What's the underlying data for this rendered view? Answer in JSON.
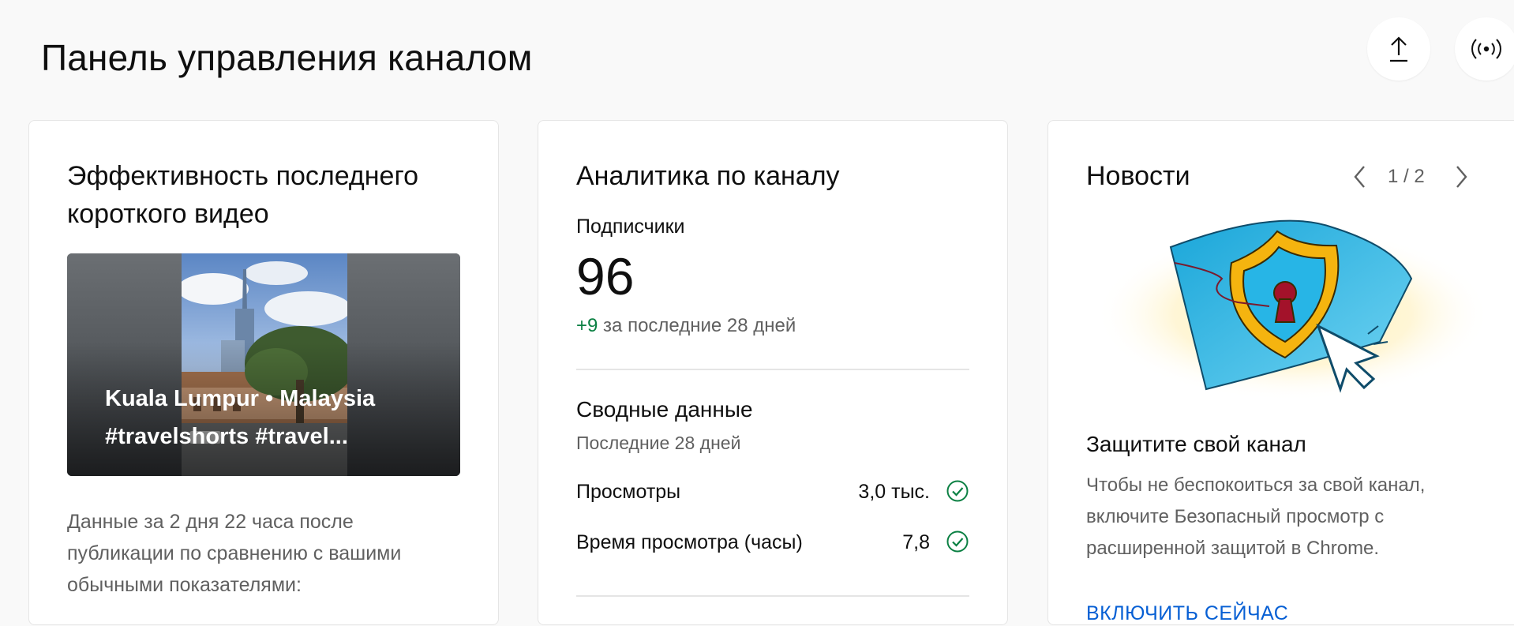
{
  "page": {
    "title": "Панель управления каналом",
    "actions": [
      {
        "icon": "upload-icon"
      },
      {
        "icon": "live-broadcast-icon"
      }
    ]
  },
  "short_video_card": {
    "title_line1": "Эффективность последнего",
    "title_line2": "короткого видео",
    "video_caption_line1": "Kuala Lumpur • Malaysia",
    "video_caption_line2": "#travelshorts #travel...",
    "note_line1": "Данные за 2 дня 22 часа после",
    "note_line2": "публикации по сравнению с вашими",
    "note_line3": "обычными показателями:"
  },
  "analytics_card": {
    "title": "Аналитика по каналу",
    "subscribers_label": "Подписчики",
    "subscribers_value": "96",
    "subscribers_delta": "+9",
    "subscribers_delta_period": "за последние 28 дней",
    "summary_title": "Сводные данные",
    "summary_period": "Последние 28 дней",
    "metrics": [
      {
        "label": "Просмотры",
        "value": "3,0 тыс.",
        "icon": "check-circle-icon"
      },
      {
        "label": "Время просмотра (часы)",
        "value": "7,8",
        "icon": "check-circle-icon"
      }
    ]
  },
  "news_card": {
    "title": "Новости",
    "pager": "1 / 2",
    "item_title": "Защитите свой канал",
    "item_text_line1": "Чтобы не беспокоиться за свой канал,",
    "item_text_line2": "включите Безопасный просмотр с",
    "item_text_line3": "расширенной защитой в Chrome.",
    "cta": "ВКЛЮЧИТЬ СЕЙЧАС"
  },
  "colors": {
    "page_bg": "#f9f9f9",
    "card_bg": "#ffffff",
    "positive_green": "#0b8043",
    "link_blue": "#065fd4",
    "muted_text": "#606060"
  }
}
